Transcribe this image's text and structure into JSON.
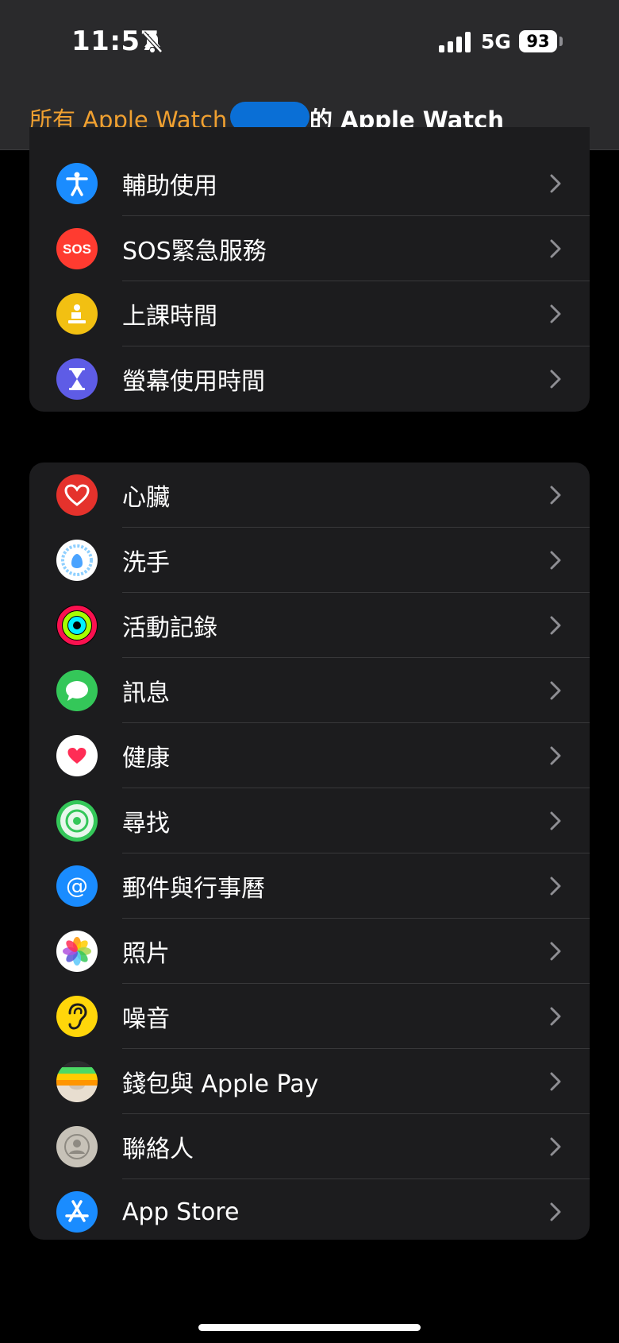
{
  "status_bar": {
    "time": "11:57",
    "network": "5G",
    "battery": "93"
  },
  "nav": {
    "back_label": "所有 Apple Watch",
    "title": "的 Apple Watch"
  },
  "group1": [
    {
      "label": "輔助使用",
      "icon": "accessibility-icon",
      "color": "#1a8cff"
    },
    {
      "label": "SOS緊急服務",
      "icon": "sos-icon",
      "color": "#ff3b30"
    },
    {
      "label": "上課時間",
      "icon": "schooltime-icon",
      "color": "#f2c012"
    },
    {
      "label": "螢幕使用時間",
      "icon": "hourglass-icon",
      "color": "#5e5ce6"
    }
  ],
  "group2": [
    {
      "label": "心臟",
      "icon": "heart-icon",
      "color": "#e5322c"
    },
    {
      "label": "洗手",
      "icon": "handwashing-icon",
      "color": "#ffffff"
    },
    {
      "label": "活動記錄",
      "icon": "activity-rings-icon",
      "color": "#000000"
    },
    {
      "label": "訊息",
      "icon": "messages-icon",
      "color": "#34c759"
    },
    {
      "label": "健康",
      "icon": "health-icon",
      "color": "#ffffff"
    },
    {
      "label": "尋找",
      "icon": "find-my-icon",
      "color": "#34c759"
    },
    {
      "label": "郵件與行事曆",
      "icon": "mail-calendar-icon",
      "color": "#1a8cff"
    },
    {
      "label": "照片",
      "icon": "photos-icon",
      "color": "#ffffff"
    },
    {
      "label": "噪音",
      "icon": "noise-ear-icon",
      "color": "#ffd60a"
    },
    {
      "label": "錢包與 Apple Pay",
      "icon": "wallet-icon",
      "color": "#2c2c2e"
    },
    {
      "label": "聯絡人",
      "icon": "contacts-icon",
      "color": "#c7c2b8"
    },
    {
      "label": "App Store",
      "icon": "app-store-icon",
      "color": "#1a8cff"
    }
  ]
}
